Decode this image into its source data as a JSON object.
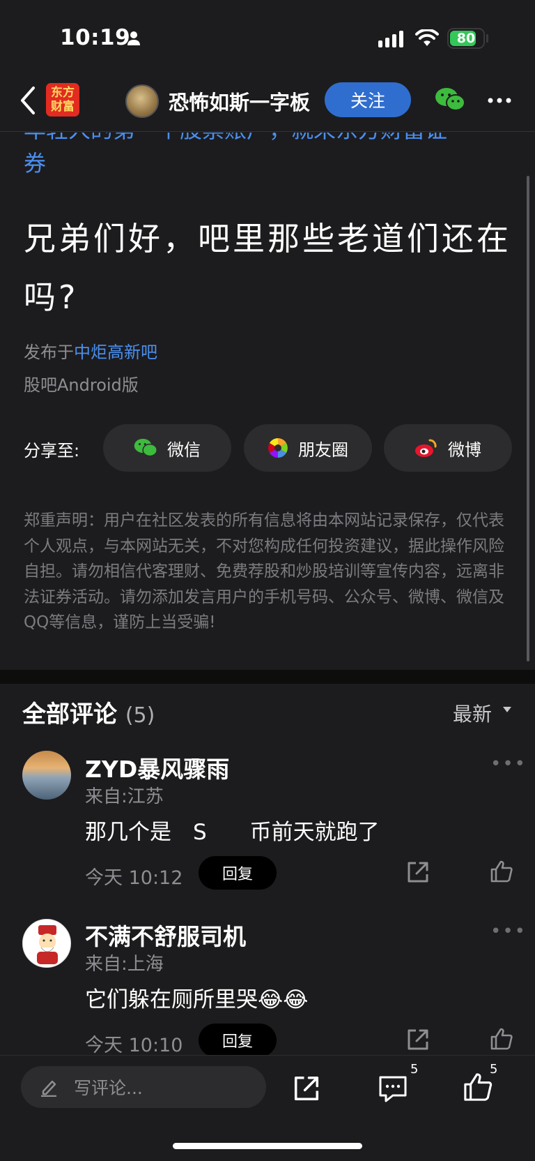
{
  "status_bar": {
    "time": "10:19",
    "battery": "80"
  },
  "nav": {
    "logo_line1": "东方",
    "logo_line2": "财富",
    "title": "恐怖如斯一字板",
    "follow_label": "关注"
  },
  "article": {
    "prev_link_line1": "年轻人的第一个股票账户，就来东方财富证",
    "prev_link_line2": "券",
    "title": "兄弟们好，吧里那些老道们还在吗?",
    "posted_prefix": "发布于",
    "posted_board": "中炬高新吧",
    "client": "股吧Android版",
    "share_label": "分享至:",
    "share_wechat": "微信",
    "share_moments": "朋友圈",
    "share_weibo": "微博",
    "disclaimer": "郑重声明：用户在社区发表的所有信息将由本网站记录保存，仅代表个人观点，与本网站无关，不对您构成任何投资建议，据此操作风险自担。请勿相信代客理财、免费荐股和炒股培训等宣传内容，远离非法证券活动。请勿添加发言用户的手机号码、公众号、微博、微信及QQ等信息，谨防上当受骗!"
  },
  "comments": {
    "header": "全部评论",
    "count": "(5)",
    "sort": "最新",
    "items": [
      {
        "name": "ZYD暴风骤雨",
        "location": "来自:江苏",
        "text": "那几个是　S　　币前天就跑了",
        "time": "今天 10:12",
        "reply": "回复"
      },
      {
        "name": "不满不舒服司机",
        "location": "来自:上海",
        "text": "它们躲在厕所里哭😂😂",
        "time": "今天 10:10",
        "reply": "回复"
      }
    ]
  },
  "bottom_bar": {
    "comment_placeholder": "写评论...",
    "comment_count": "5",
    "like_count": "5"
  },
  "colors": {
    "background": "#1c1c1e",
    "accent_blue": "#2f6ecf",
    "link_blue": "#4a8ff0",
    "muted": "#8e8e93",
    "wechat_green": "#3dbb3d",
    "weibo_red": "#e6162d"
  }
}
